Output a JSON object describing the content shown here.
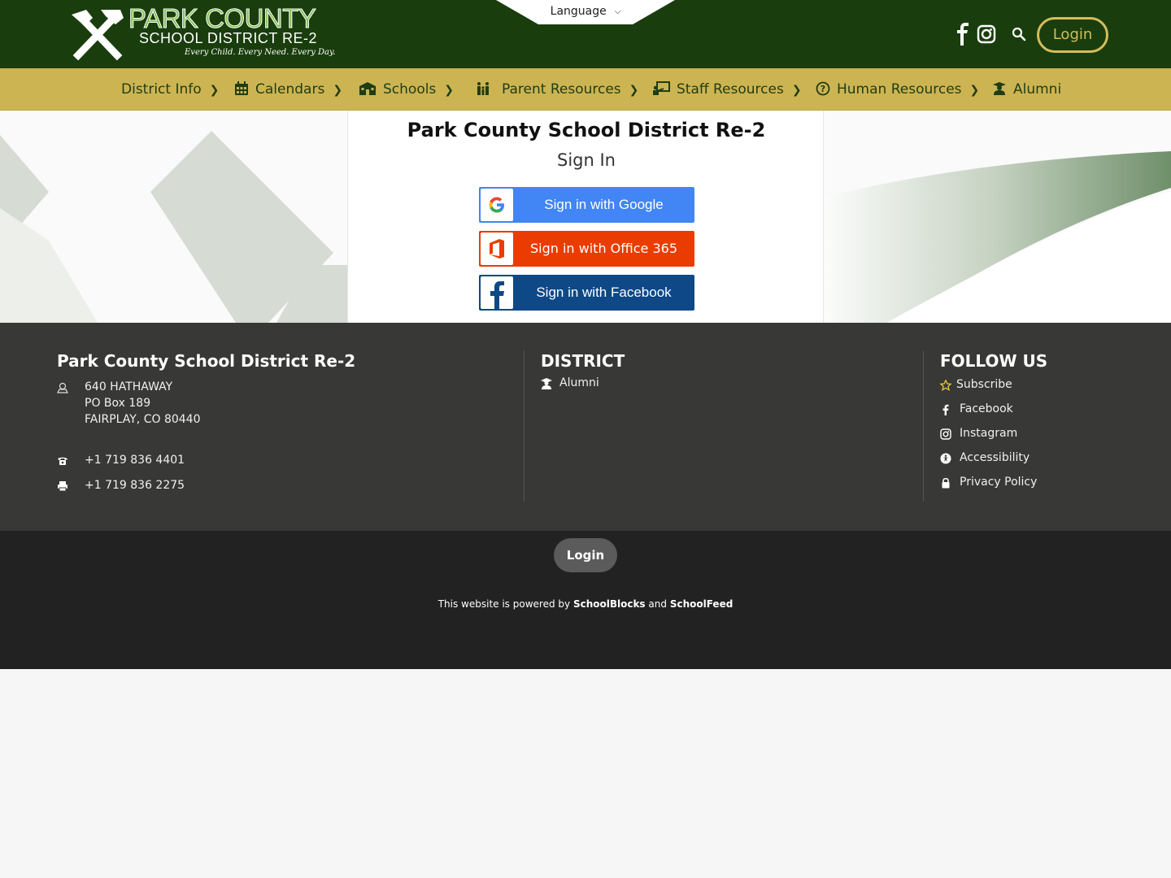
{
  "header": {
    "logo": {
      "line1": "PARK COUNTY",
      "line2": "SCHOOL DISTRICT RE-2",
      "tagline": "Every Child. Every Need. Every Day."
    },
    "language_label": "Language",
    "icons": [
      "facebook-icon",
      "instagram-icon",
      "search-icon"
    ],
    "login_label": "Login"
  },
  "nav": {
    "items": [
      {
        "label": "District Info",
        "icon": "none",
        "has_submenu": true
      },
      {
        "label": "Calendars",
        "icon": "calendar-icon",
        "has_submenu": true
      },
      {
        "label": "Schools",
        "icon": "school-icon",
        "has_submenu": true
      },
      {
        "label": "Parent Resources",
        "icon": "family-icon",
        "has_submenu": true
      },
      {
        "label": "Staff Resources",
        "icon": "teacher-icon",
        "has_submenu": true
      },
      {
        "label": "Human Resources",
        "icon": "question-circle-icon",
        "has_submenu": true
      },
      {
        "label": "Alumni",
        "icon": "graduate-icon",
        "has_submenu": false
      }
    ]
  },
  "signin": {
    "title": "Park County School District Re-2",
    "subtitle": "Sign In",
    "google_label": "Sign in with Google",
    "office_label": "Sign in with Office 365",
    "facebook_label": "Sign in with Facebook"
  },
  "footer": {
    "district_name": "Park County School District Re-2",
    "address": [
      "640 HATHAWAY",
      "PO Box 189",
      "FAIRPLAY, CO 80440"
    ],
    "phone": "+1 719 836 4401",
    "fax": "+1 719 836 2275",
    "district_heading": "DISTRICT",
    "district_links": [
      "Alumni"
    ],
    "follow_heading": "FOLLOW US",
    "follow_links": [
      "Subscribe",
      "Facebook",
      "Instagram",
      "Accessibility",
      "Privacy Policy"
    ]
  },
  "bottom": {
    "login_label": "Login",
    "powered_prefix": "This website is powered by",
    "powered_brand1": "SchoolBlocks",
    "powered_and": "and",
    "powered_brand2": "SchoolFeed"
  },
  "colors": {
    "header_bg": "#1a3d0d",
    "nav_bg": "#cdb453",
    "google_blue": "#4285f4",
    "office_red": "#eb3c00",
    "facebook_blue": "#0e4886",
    "footer_bg": "#383836",
    "bottom_bg": "#222222"
  }
}
